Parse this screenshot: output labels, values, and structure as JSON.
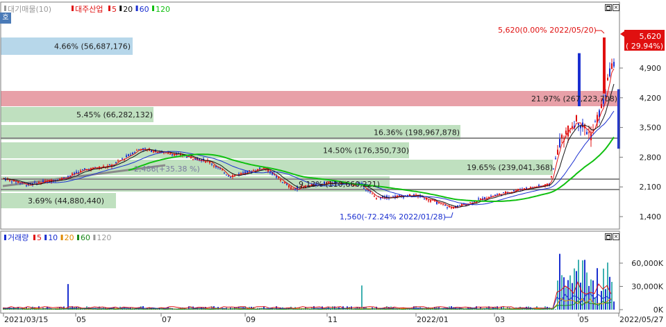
{
  "legend": {
    "price_items": [
      {
        "label": "대기매물(10)",
        "color": "#9a9a9a"
      },
      {
        "label": "대주산업",
        "color": "#e01010"
      },
      {
        "label": "5",
        "color": "#e01010"
      },
      {
        "label": "20",
        "color": "#111111"
      },
      {
        "label": "60",
        "color": "#1a2fd0"
      },
      {
        "label": "120",
        "color": "#10c010"
      }
    ],
    "volume_items": [
      {
        "label": "거래량",
        "color": "#1a2fd0"
      },
      {
        "label": "5",
        "color": "#e01010"
      },
      {
        "label": "10",
        "color": "#1a2fd0"
      },
      {
        "label": "20",
        "color": "#e08a00"
      },
      {
        "label": "60",
        "color": "#1a8a1a"
      },
      {
        "label": "120",
        "color": "#9a9a9a"
      }
    ]
  },
  "side_tab": {
    "label": "호"
  },
  "price_axis": {
    "ticks": [
      "4,900",
      "4,200",
      "3,500",
      "2,800",
      "2,100",
      "1,400"
    ],
    "tick_values": [
      4900,
      4200,
      3500,
      2800,
      2100,
      1400
    ]
  },
  "volume_axis": {
    "ticks": [
      "60,000K",
      "30,000K",
      "0K"
    ],
    "tick_values": [
      60000,
      30000,
      0
    ]
  },
  "date_axis": {
    "ticks": [
      "2021/03/15",
      "05",
      "07",
      "09",
      "11",
      "2022/01",
      "03",
      "05",
      "2022/05/27"
    ]
  },
  "last_price_badge": {
    "price": "5,620",
    "change": "( 29.94%)"
  },
  "supply_bands": [
    {
      "label": "4.66% (56,687,176)",
      "pct": 4.66,
      "color": "#b7d7ea"
    },
    {
      "label": "21.97% (267,223,708)",
      "pct": 21.97,
      "color": "#e8a0a8"
    },
    {
      "label": "5.45% (66,282,132)",
      "pct": 5.45,
      "color": "#bfe0bf"
    },
    {
      "label": "16.36% (198,967,878)",
      "pct": 16.36,
      "color": "#bfe0bf"
    },
    {
      "label": "14.50% (176,350,730)",
      "pct": 14.5,
      "color": "#bfe0bf"
    },
    {
      "label": "19.65% (239,041,368)",
      "pct": 19.65,
      "color": "#bfe0bf"
    },
    {
      "label": "9.12% (110,660,221)",
      "pct": 9.12,
      "color": "#bfe0bf"
    },
    {
      "label": "3.69% (44,880,440)",
      "pct": 3.69,
      "color": "#bfe0bf"
    }
  ],
  "annotations": {
    "high": "5,620(0.00% 2022/05/20)",
    "low": "1,560(-72.24% 2022/01/28)",
    "trend": "2,486(+35.38 %)"
  },
  "colors": {
    "up": "#e01010",
    "down": "#1a2fd0",
    "grid": "#dcdcdc"
  }
}
